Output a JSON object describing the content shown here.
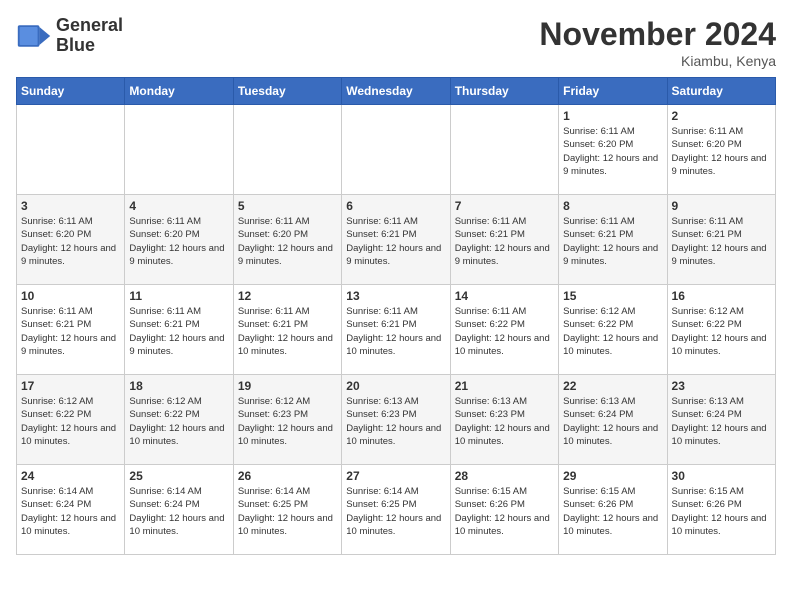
{
  "logo": {
    "line1": "General",
    "line2": "Blue"
  },
  "title": "November 2024",
  "location": "Kiambu, Kenya",
  "weekdays": [
    "Sunday",
    "Monday",
    "Tuesday",
    "Wednesday",
    "Thursday",
    "Friday",
    "Saturday"
  ],
  "weeks": [
    [
      {
        "day": "",
        "info": ""
      },
      {
        "day": "",
        "info": ""
      },
      {
        "day": "",
        "info": ""
      },
      {
        "day": "",
        "info": ""
      },
      {
        "day": "",
        "info": ""
      },
      {
        "day": "1",
        "info": "Sunrise: 6:11 AM\nSunset: 6:20 PM\nDaylight: 12 hours and 9 minutes."
      },
      {
        "day": "2",
        "info": "Sunrise: 6:11 AM\nSunset: 6:20 PM\nDaylight: 12 hours and 9 minutes."
      }
    ],
    [
      {
        "day": "3",
        "info": "Sunrise: 6:11 AM\nSunset: 6:20 PM\nDaylight: 12 hours and 9 minutes."
      },
      {
        "day": "4",
        "info": "Sunrise: 6:11 AM\nSunset: 6:20 PM\nDaylight: 12 hours and 9 minutes."
      },
      {
        "day": "5",
        "info": "Sunrise: 6:11 AM\nSunset: 6:20 PM\nDaylight: 12 hours and 9 minutes."
      },
      {
        "day": "6",
        "info": "Sunrise: 6:11 AM\nSunset: 6:21 PM\nDaylight: 12 hours and 9 minutes."
      },
      {
        "day": "7",
        "info": "Sunrise: 6:11 AM\nSunset: 6:21 PM\nDaylight: 12 hours and 9 minutes."
      },
      {
        "day": "8",
        "info": "Sunrise: 6:11 AM\nSunset: 6:21 PM\nDaylight: 12 hours and 9 minutes."
      },
      {
        "day": "9",
        "info": "Sunrise: 6:11 AM\nSunset: 6:21 PM\nDaylight: 12 hours and 9 minutes."
      }
    ],
    [
      {
        "day": "10",
        "info": "Sunrise: 6:11 AM\nSunset: 6:21 PM\nDaylight: 12 hours and 9 minutes."
      },
      {
        "day": "11",
        "info": "Sunrise: 6:11 AM\nSunset: 6:21 PM\nDaylight: 12 hours and 9 minutes."
      },
      {
        "day": "12",
        "info": "Sunrise: 6:11 AM\nSunset: 6:21 PM\nDaylight: 12 hours and 10 minutes."
      },
      {
        "day": "13",
        "info": "Sunrise: 6:11 AM\nSunset: 6:21 PM\nDaylight: 12 hours and 10 minutes."
      },
      {
        "day": "14",
        "info": "Sunrise: 6:11 AM\nSunset: 6:22 PM\nDaylight: 12 hours and 10 minutes."
      },
      {
        "day": "15",
        "info": "Sunrise: 6:12 AM\nSunset: 6:22 PM\nDaylight: 12 hours and 10 minutes."
      },
      {
        "day": "16",
        "info": "Sunrise: 6:12 AM\nSunset: 6:22 PM\nDaylight: 12 hours and 10 minutes."
      }
    ],
    [
      {
        "day": "17",
        "info": "Sunrise: 6:12 AM\nSunset: 6:22 PM\nDaylight: 12 hours and 10 minutes."
      },
      {
        "day": "18",
        "info": "Sunrise: 6:12 AM\nSunset: 6:22 PM\nDaylight: 12 hours and 10 minutes."
      },
      {
        "day": "19",
        "info": "Sunrise: 6:12 AM\nSunset: 6:23 PM\nDaylight: 12 hours and 10 minutes."
      },
      {
        "day": "20",
        "info": "Sunrise: 6:13 AM\nSunset: 6:23 PM\nDaylight: 12 hours and 10 minutes."
      },
      {
        "day": "21",
        "info": "Sunrise: 6:13 AM\nSunset: 6:23 PM\nDaylight: 12 hours and 10 minutes."
      },
      {
        "day": "22",
        "info": "Sunrise: 6:13 AM\nSunset: 6:24 PM\nDaylight: 12 hours and 10 minutes."
      },
      {
        "day": "23",
        "info": "Sunrise: 6:13 AM\nSunset: 6:24 PM\nDaylight: 12 hours and 10 minutes."
      }
    ],
    [
      {
        "day": "24",
        "info": "Sunrise: 6:14 AM\nSunset: 6:24 PM\nDaylight: 12 hours and 10 minutes."
      },
      {
        "day": "25",
        "info": "Sunrise: 6:14 AM\nSunset: 6:24 PM\nDaylight: 12 hours and 10 minutes."
      },
      {
        "day": "26",
        "info": "Sunrise: 6:14 AM\nSunset: 6:25 PM\nDaylight: 12 hours and 10 minutes."
      },
      {
        "day": "27",
        "info": "Sunrise: 6:14 AM\nSunset: 6:25 PM\nDaylight: 12 hours and 10 minutes."
      },
      {
        "day": "28",
        "info": "Sunrise: 6:15 AM\nSunset: 6:26 PM\nDaylight: 12 hours and 10 minutes."
      },
      {
        "day": "29",
        "info": "Sunrise: 6:15 AM\nSunset: 6:26 PM\nDaylight: 12 hours and 10 minutes."
      },
      {
        "day": "30",
        "info": "Sunrise: 6:15 AM\nSunset: 6:26 PM\nDaylight: 12 hours and 10 minutes."
      }
    ]
  ]
}
